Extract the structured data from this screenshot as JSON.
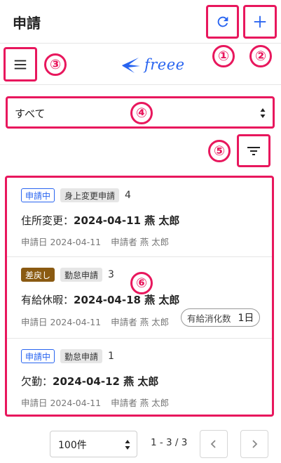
{
  "header": {
    "title": "申請"
  },
  "brand": {
    "logo_text": "freee"
  },
  "callouts": [
    "①",
    "②",
    "③",
    "④",
    "⑤",
    "⑥"
  ],
  "filter": {
    "status_value": "すべて"
  },
  "items": [
    {
      "status": "申請中",
      "type": "身上変更申請",
      "count": "4",
      "kind": "住所変更：",
      "title": "2024-04-11 燕 太郎",
      "date": "申請日 2024-04-11",
      "applicant": "申請者 燕 太郎"
    },
    {
      "status": "差戻し",
      "type": "勤怠申請",
      "count": "3",
      "kind": "有給休暇：",
      "title": "2024-04-18 燕 太郎",
      "date": "申請日 2024-04-11",
      "applicant": "申請者 燕 太郎",
      "leave_label": "有給消化数",
      "leave_value": "1日"
    },
    {
      "status": "申請中",
      "type": "勤怠申請",
      "count": "1",
      "kind": "欠勤：",
      "title": "2024-04-12 燕 太郎",
      "date": "申請日 2024-04-11",
      "applicant": "申請者 燕 太郎"
    }
  ],
  "pagination": {
    "per_page": "100件",
    "range": "1 - 3 / 3"
  },
  "colors": {
    "accent": "#2864f0",
    "highlight": "#e8175d",
    "returned": "#8a5a12"
  },
  "icons": [
    "reload-icon",
    "plus-icon",
    "hamburger-menu-icon",
    "freee-bird-icon",
    "filter-icon",
    "chevron-left-icon",
    "chevron-right-icon"
  ]
}
